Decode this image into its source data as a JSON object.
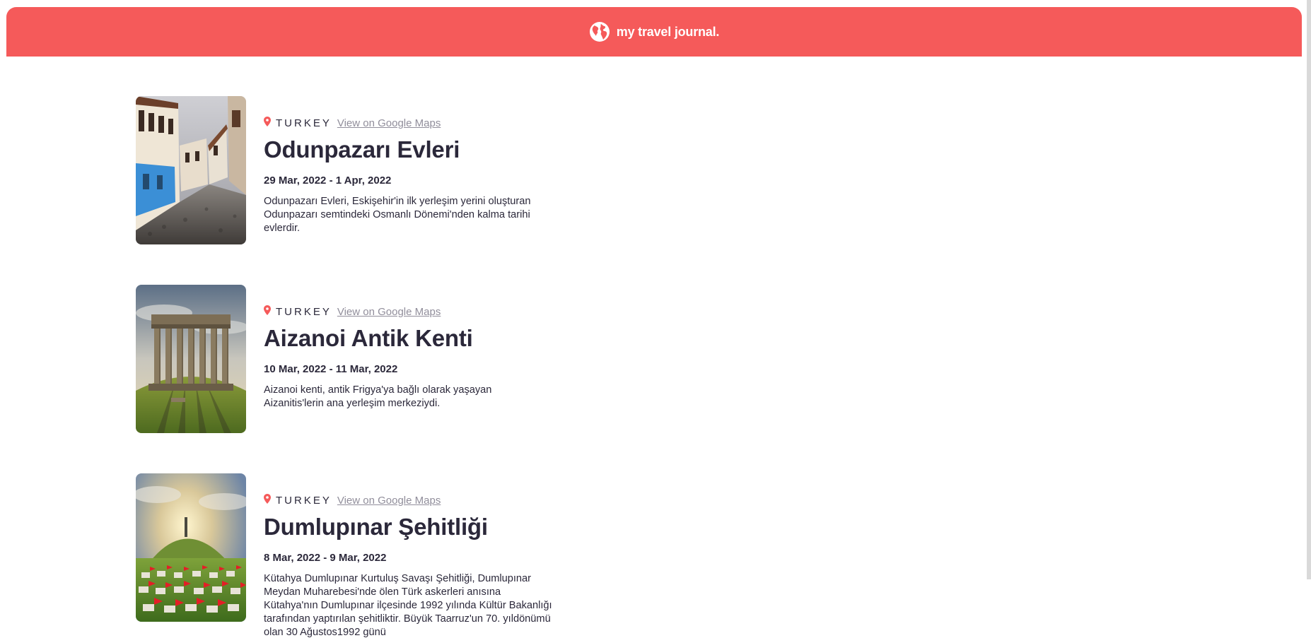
{
  "header": {
    "title": "my travel journal.",
    "icon": "globe-icon",
    "bg_color": "#f55a5a"
  },
  "colors": {
    "accent": "#f55a5a",
    "text": "#2b283a",
    "link": "#918e9b"
  },
  "entries": [
    {
      "country": "TURKEY",
      "maps_link": "View on Google Maps",
      "title": "Odunpazarı Evleri",
      "dates": "29 Mar, 2022 - 1 Apr, 2022",
      "description": "Odunpazarı Evleri, Eskişehir'in ilk yerleşim yerini oluşturan Odunpazarı semtindeki Osmanlı Dönemi'nden kalma tarihi evlerdir."
    },
    {
      "country": "TURKEY",
      "maps_link": "View on Google Maps",
      "title": "Aizanoi Antik Kenti",
      "dates": "10 Mar, 2022 - 11 Mar, 2022",
      "description": "Aizanoi kenti, antik Frigya'ya bağlı olarak yaşayan Aizanitis'lerin ana yerleşim merkeziydi."
    },
    {
      "country": "TURKEY",
      "maps_link": "View on Google Maps",
      "title": "Dumlupınar Şehitliği",
      "dates": "8 Mar, 2022 - 9 Mar, 2022",
      "description": "Kütahya Dumlupınar Kurtuluş Savaşı Şehitliği, Dumlupınar Meydan Muharebesi'nde ölen Türk askerleri anısına Kütahya'nın Dumlupınar ilçesinde 1992 yılında Kültür Bakanlığı tarafından yaptırılan şehitliktir. Büyük Taarruz'un 70. yıldönümü olan 30 Ağustos1992 günü"
    }
  ]
}
